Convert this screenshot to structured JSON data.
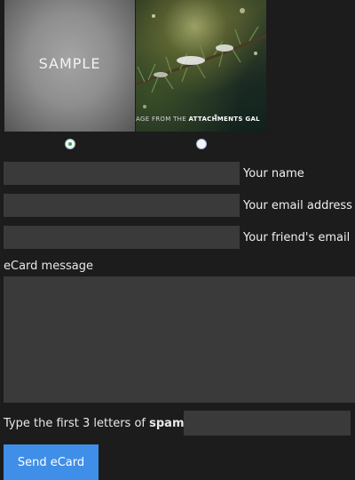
{
  "cards": {
    "sample_text": "SAMPLE",
    "photo_caption_prefix": "AGE FROM THE ",
    "photo_caption_bold": "ATTACHMENTS GAL"
  },
  "fields": {
    "name_label": "Your name",
    "email_label": "Your email address",
    "friend_email_label": "Your friend's email",
    "message_label": "eCard message",
    "spam_prefix": "Type the first 3 letters of ",
    "spam_bold": "spam",
    "send_label": "Send eCard"
  },
  "selection": {
    "selected_card": "sample"
  },
  "colors": {
    "background": "#1c1c1c",
    "field": "#3a3a3a",
    "button": "#3f8fe8",
    "radio_checked": "#2fae3a"
  }
}
